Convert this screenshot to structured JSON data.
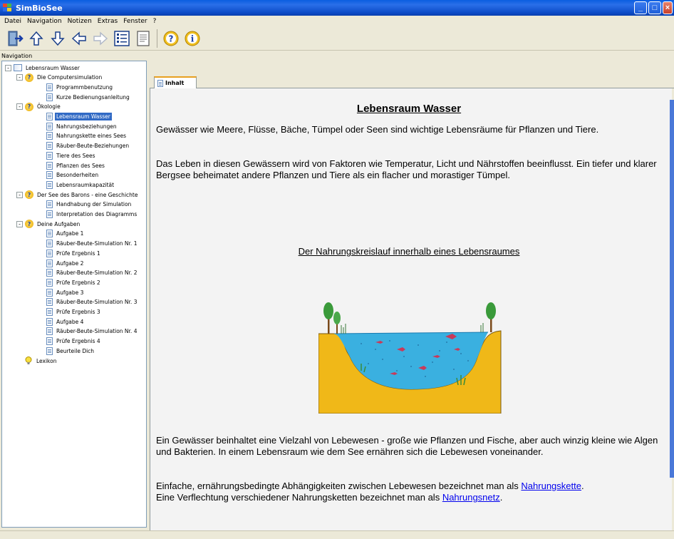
{
  "window": {
    "title": "SimBioSee"
  },
  "menu": [
    "Datei",
    "Navigation",
    "Notizen",
    "Extras",
    "Fenster",
    "?"
  ],
  "toolbar": {
    "icons": [
      "exit-icon",
      "arrow-up-icon",
      "arrow-down-icon",
      "arrow-left-icon",
      "arrow-right-icon",
      "tree-view-icon",
      "document-icon",
      "help-icon",
      "info-icon"
    ]
  },
  "navigation": {
    "header": "Navigation",
    "tree": [
      {
        "label": "Lebensraum Wasser",
        "level": 0,
        "icon": "book",
        "expander": "-"
      },
      {
        "label": "Die Computersimulation",
        "level": 1,
        "icon": "help",
        "expander": "-"
      },
      {
        "label": "Programmbenutzung",
        "level": 2,
        "icon": "doc"
      },
      {
        "label": "Kurze Bedienungsanleitung",
        "level": 2,
        "icon": "doc"
      },
      {
        "label": "Ökologie",
        "level": 1,
        "icon": "help",
        "expander": "-"
      },
      {
        "label": "Lebensraum Wasser",
        "level": 2,
        "icon": "doc",
        "selected": true
      },
      {
        "label": "Nahrungsbeziehungen",
        "level": 2,
        "icon": "doc"
      },
      {
        "label": "Nahrungskette eines Sees",
        "level": 2,
        "icon": "doc"
      },
      {
        "label": "Räuber-Beute-Beziehungen",
        "level": 2,
        "icon": "doc"
      },
      {
        "label": "Tiere des Sees",
        "level": 2,
        "icon": "doc"
      },
      {
        "label": "Pflanzen des Sees",
        "level": 2,
        "icon": "doc"
      },
      {
        "label": "Besonderheiten",
        "level": 2,
        "icon": "doc"
      },
      {
        "label": "Lebensraumkapazität",
        "level": 2,
        "icon": "doc"
      },
      {
        "label": "Der See des Barons - eine Geschichte",
        "level": 1,
        "icon": "help",
        "expander": "-"
      },
      {
        "label": "Handhabung der Simulation",
        "level": 2,
        "icon": "doc"
      },
      {
        "label": "Interpretation des Diagramms",
        "level": 2,
        "icon": "doc"
      },
      {
        "label": "Deine Aufgaben",
        "level": 1,
        "icon": "help",
        "expander": "-"
      },
      {
        "label": "Aufgabe 1",
        "level": 2,
        "icon": "doc"
      },
      {
        "label": "Räuber-Beute-Simulation Nr. 1",
        "level": 2,
        "icon": "doc"
      },
      {
        "label": "Prüfe Ergebnis 1",
        "level": 2,
        "icon": "doc"
      },
      {
        "label": "Aufgabe 2",
        "level": 2,
        "icon": "doc"
      },
      {
        "label": "Räuber-Beute-Simulation Nr. 2",
        "level": 2,
        "icon": "doc"
      },
      {
        "label": "Prüfe Ergebnis 2",
        "level": 2,
        "icon": "doc"
      },
      {
        "label": "Aufgabe 3",
        "level": 2,
        "icon": "doc"
      },
      {
        "label": "Räuber-Beute-Simulation Nr. 3",
        "level": 2,
        "icon": "doc"
      },
      {
        "label": "Prüfe Ergebnis 3",
        "level": 2,
        "icon": "doc"
      },
      {
        "label": "Aufgabe 4",
        "level": 2,
        "icon": "doc"
      },
      {
        "label": "Räuber-Beute-Simulation Nr. 4",
        "level": 2,
        "icon": "doc"
      },
      {
        "label": "Prüfe Ergebnis 4",
        "level": 2,
        "icon": "doc"
      },
      {
        "label": "Beurteile Dich",
        "level": 2,
        "icon": "doc"
      },
      {
        "label": "Lexikon",
        "level": 1,
        "icon": "bulb"
      }
    ]
  },
  "tabs": [
    {
      "label": "Inhalt"
    }
  ],
  "content": {
    "heading": "Lebensraum Wasser",
    "para1": "Gewässer wie Meere, Flüsse, Bäche, Tümpel oder Seen sind wichtige Lebensräume für Pflanzen und Tiere.",
    "para2": "Das Leben in diesen Gewässern wird von Faktoren wie Temperatur, Licht und Nährstoffen beeinflusst. Ein tiefer und klarer Bergsee beheimatet andere Pflanzen und Tiere als ein flacher und morastiger Tümpel.",
    "subheading": "Der Nahrungskreislauf innerhalb eines Lebensraumes",
    "para3": "Ein Gewässer beinhaltet eine Vielzahl von Lebewesen - große wie Pflanzen und Fische, aber auch winzig kleine wie Algen und Bakterien. In einem Lebensraum wie dem See ernähren sich die Lebewesen voneinander.",
    "para4_before": "Einfache, ernährungsbedingte Abhängigkeiten zwischen Lebewesen bezeichnet man als ",
    "para4_link": "Nahrungskette",
    "para4_after": ".",
    "para5_before": "Eine Verflechtung verschiedener Nahrungsketten bezeichnet man als ",
    "para5_link": "Nahrungsnetz",
    "para5_after": "."
  },
  "colors": {
    "selection": "#316ac5",
    "link": "#0000ee",
    "water": "#3ab0e0",
    "sediment": "#f0b818"
  }
}
